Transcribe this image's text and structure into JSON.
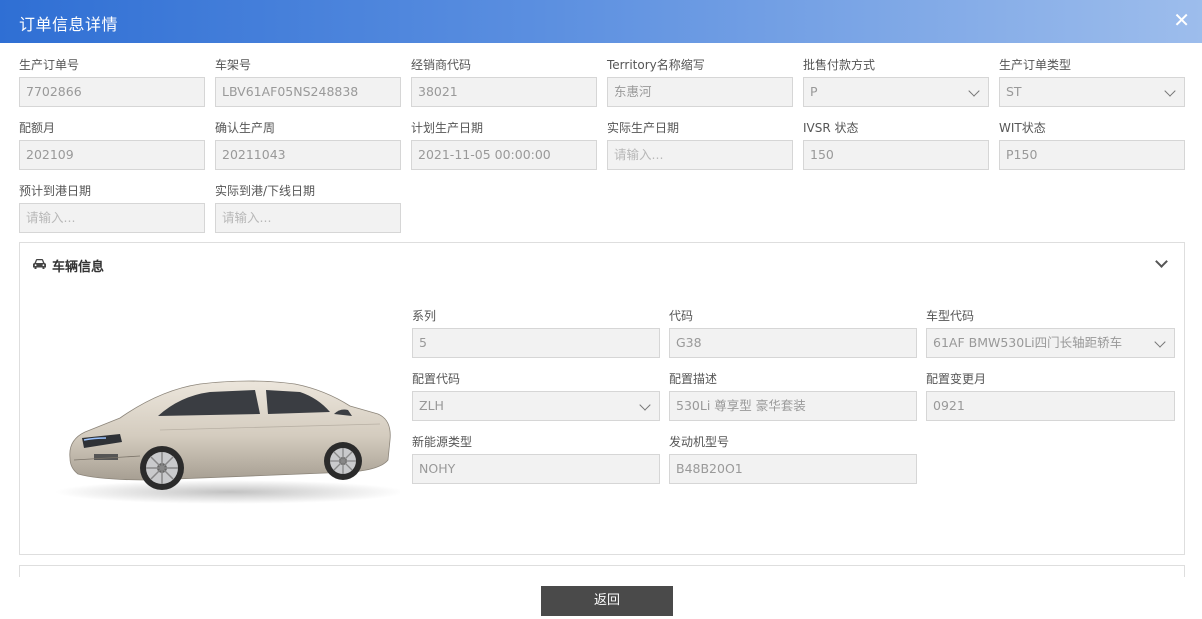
{
  "dialog": {
    "title": "订单信息详情",
    "close_glyph": "✕"
  },
  "fields_row1": [
    {
      "label": "生产订单号",
      "value": "7702866"
    },
    {
      "label": "车架号",
      "value": "LBV61AF05NS248838"
    },
    {
      "label": "经销商代码",
      "value": "38021"
    },
    {
      "label": "Territory名称缩写",
      "value": "东惠河"
    },
    {
      "label": "批售付款方式",
      "value": "P"
    },
    {
      "label": "生产订单类型",
      "value": "ST"
    }
  ],
  "fields_row2": [
    {
      "label": "配额月",
      "value": "202109"
    },
    {
      "label": "确认生产周",
      "value": "20211043"
    },
    {
      "label": "计划生产日期",
      "value": "2021-11-05 00:00:00"
    },
    {
      "label": "实际生产日期",
      "placeholder": "请输入..."
    },
    {
      "label": "IVSR 状态",
      "value": "150"
    },
    {
      "label": "WIT状态",
      "value": "P150"
    }
  ],
  "fields_row3": [
    {
      "label": "预计到港日期",
      "placeholder": "请输入..."
    },
    {
      "label": "实际到港/下线日期",
      "placeholder": "请输入..."
    }
  ],
  "vehicle": {
    "title": "车辆信息",
    "icon": "car-icon",
    "fields": [
      {
        "label": "系列",
        "value": "5"
      },
      {
        "label": "代码",
        "value": "G38"
      },
      {
        "label": "车型代码",
        "value": "61AF BMW530Li四门长轴距轿车"
      },
      {
        "label": "配置代码",
        "value": "ZLH"
      },
      {
        "label": "配置描述",
        "value": "530Li 尊享型 豪华套装"
      },
      {
        "label": "配置变更月",
        "value": "0921"
      },
      {
        "label": "新能源类型",
        "value": "NOHY"
      },
      {
        "label": "发动机型号",
        "value": "B48B20O1"
      }
    ]
  },
  "footer": {
    "back_label": "返回"
  },
  "colors": {
    "title_gradient_start": "#2f6fd4",
    "title_gradient_end": "#9dbdec",
    "button_bg": "#4a4a4a",
    "field_bg": "#f2f2f2"
  }
}
